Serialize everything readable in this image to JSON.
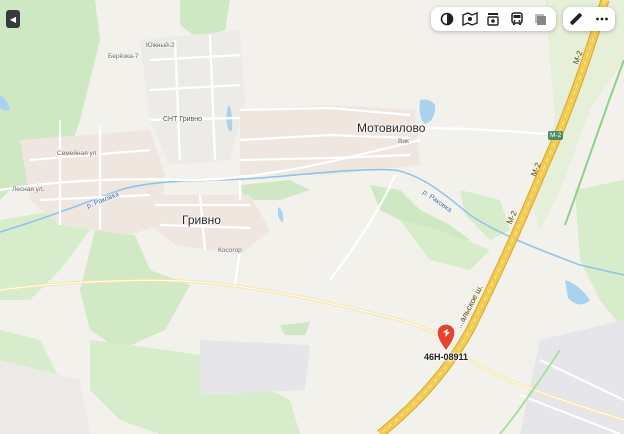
{
  "map": {
    "places": {
      "motovilovo": "Мотовилово",
      "grivno": "Гривно",
      "snt_grivno": "СНТ Гривно",
      "berezka": "Берёзка-7",
      "yuzhny": "Южный-2",
      "kosogor": "Косогор",
      "vik": "Вик"
    },
    "streets": {
      "semeynaya": "Семейная ул.",
      "lesnaya": "Лесная ул."
    },
    "rivers": {
      "rakovka_left": "р. Раковка",
      "rakovka_right": "р. Раковка"
    },
    "roads": {
      "m2_label_upper": "М-2",
      "m2_label_lower": "М-2",
      "m2_shield": "М-2",
      "m2_top": "М-2",
      "simferopol": "...альское ш."
    },
    "marker": {
      "label": "46Н-08911",
      "color": "#e8432c"
    }
  },
  "toolbar": {
    "items": [
      "layers-icon",
      "panorama-icon",
      "traffic-camera-icon",
      "transport-icon",
      "layer-toggle-icon"
    ],
    "tools": [
      "ruler-icon",
      "more-icon"
    ]
  },
  "colors": {
    "forest": "#cfe8c4",
    "road_major": "#e8c14a",
    "water": "#a9d2ef"
  }
}
